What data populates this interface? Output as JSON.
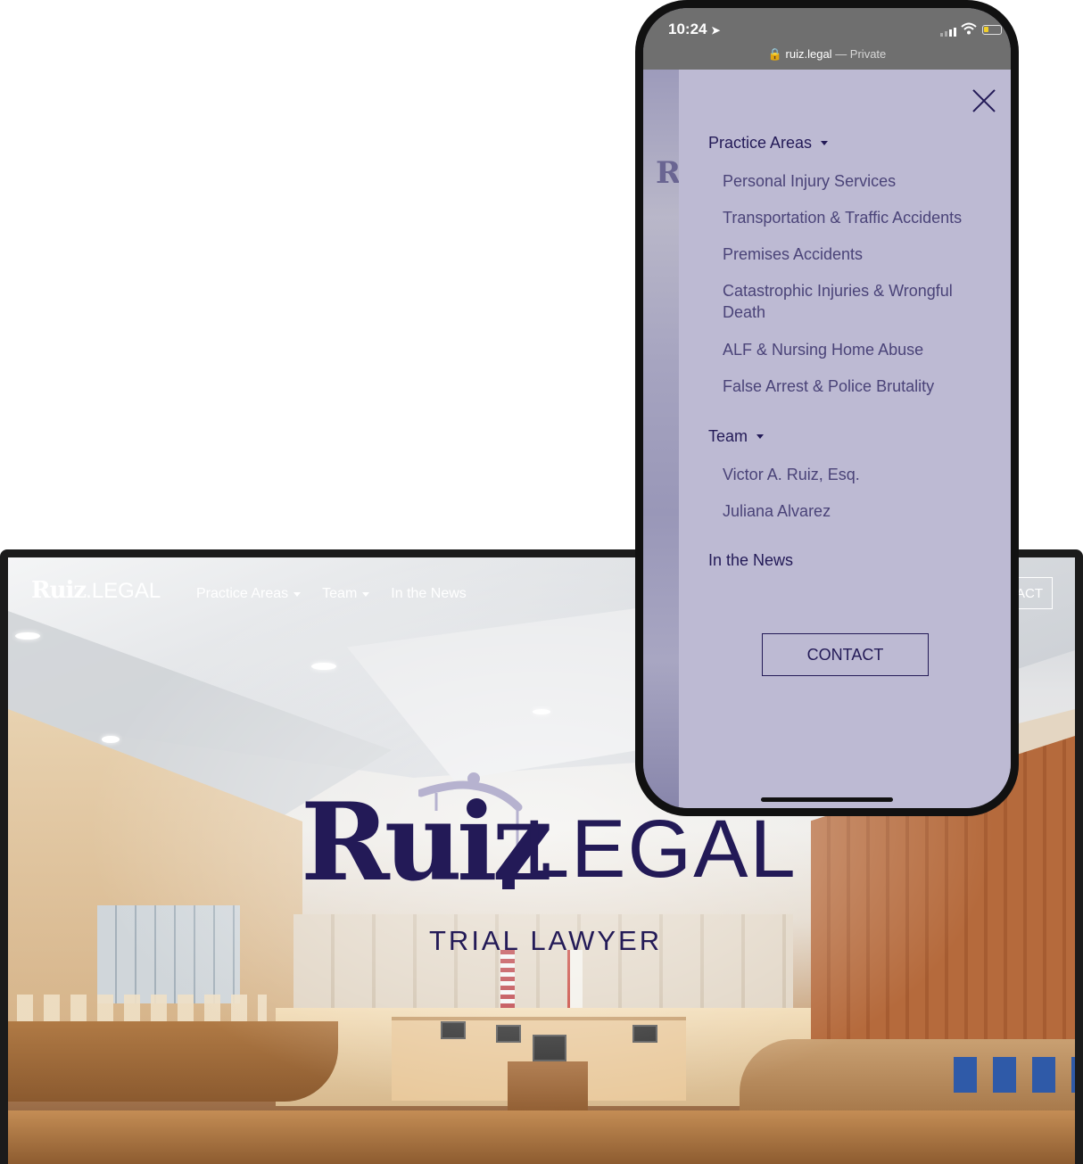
{
  "desktop": {
    "logo_main": "Ruiz",
    "logo_suffix": ".LEGAL",
    "nav": [
      {
        "label": "Practice Areas",
        "dropdown": true
      },
      {
        "label": "Team",
        "dropdown": true
      },
      {
        "label": "In the News",
        "dropdown": false
      }
    ],
    "contact_label": "ACT",
    "hero": {
      "logo_main": "Ruiz",
      "logo_suffix": "LEGAL",
      "subtitle": "TRIAL LAWYER"
    }
  },
  "phone": {
    "time": "10:24",
    "url": "ruiz.legal",
    "url_suffix": " — Private",
    "strip_text": "Ru",
    "menu": {
      "close_icon": "close-icon",
      "sections": [
        {
          "label": "Practice Areas",
          "items": [
            "Personal Injury Services",
            "Transportation & Traffic Accidents",
            "Premises Accidents",
            "Catastrophic Injuries & Wrongful Death",
            "ALF & Nursing Home Abuse",
            "False Arrest & Police Brutality"
          ]
        },
        {
          "label": "Team",
          "items": [
            "Victor A. Ruiz, Esq.",
            "Juliana Alvarez"
          ]
        },
        {
          "label": "In the News",
          "items": []
        }
      ],
      "contact_label": "CONTACT"
    }
  },
  "colors": {
    "brand_navy": "#231a57",
    "menu_bg": "#bdbad3",
    "menu_sub_text": "#4a4378",
    "status_bar": "#6f6f6f"
  }
}
